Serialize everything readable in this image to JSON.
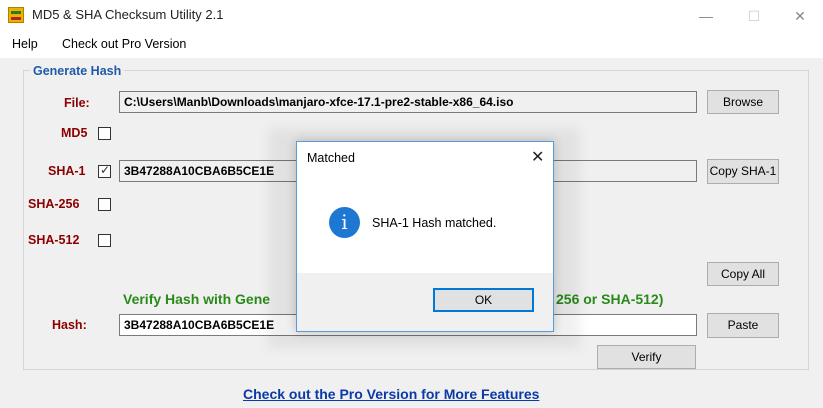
{
  "window": {
    "title": "MD5 & SHA Checksum Utility 2.1",
    "app_icon": "checksum-app-icon",
    "controls": {
      "minimize": "—",
      "maximize": "☐",
      "close": "✕"
    }
  },
  "menu": {
    "items": [
      "Help",
      "Check out Pro Version"
    ]
  },
  "generate": {
    "group_title": "Generate Hash",
    "file_label": "File:",
    "file_path": "C:\\Users\\Manb\\Downloads\\manjaro-xfce-17.1-pre2-stable-x86_64.iso",
    "browse_label": "Browse",
    "md5_label": "MD5",
    "md5_checked": false,
    "sha1_label": "SHA-1",
    "sha1_checked": true,
    "sha1_value": "3B47288A10CBA6B5CE1E",
    "copy_sha1_label": "Copy SHA-1",
    "sha256_label": "SHA-256",
    "sha256_checked": false,
    "sha512_label": "SHA-512",
    "sha512_checked": false,
    "copy_all_label": "Copy All"
  },
  "verify": {
    "title_left": "Verify Hash with Gene",
    "title_right": "256 or SHA-512)",
    "hash_label": "Hash:",
    "hash_value": "3B47288A10CBA6B5CE1E",
    "paste_label": "Paste",
    "verify_label": "Verify"
  },
  "footer": {
    "pro_link": "Check out the Pro Version for More Features"
  },
  "dialog": {
    "title": "Matched",
    "close": "✕",
    "icon": "info-icon",
    "message": "SHA-1 Hash matched.",
    "ok_label": "OK"
  },
  "colors": {
    "label_red": "#8b0000",
    "group_blue": "#1e5aa8",
    "verify_green": "#2a8a1a",
    "link_blue": "#0a3aa8",
    "info_blue": "#1e78d2"
  }
}
